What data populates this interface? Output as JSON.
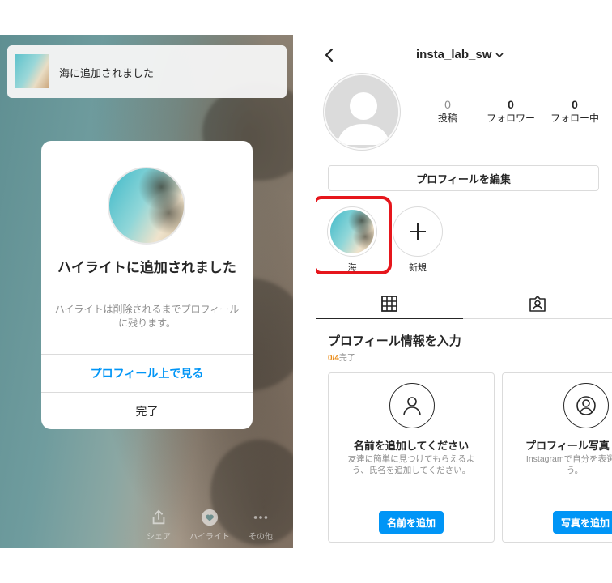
{
  "left_panel": {
    "toast": {
      "text": "海に追加されました"
    },
    "dialog": {
      "title": "ハイライトに追加されました",
      "description": "ハイライトは削除されるまでプロフィールに残ります。",
      "primary_action": "プロフィール上で見る",
      "secondary_action": "完了"
    },
    "bottom_tools": [
      {
        "label": "シェア",
        "icon": "share-icon"
      },
      {
        "label": "ハイライト",
        "icon": "heart-icon"
      },
      {
        "label": "その他",
        "icon": "more-icon"
      }
    ]
  },
  "right_panel": {
    "header": {
      "username": "insta_lab_sw"
    },
    "stats": [
      {
        "value": "0",
        "label": "投稿"
      },
      {
        "value": "0",
        "label": "フォロワー"
      },
      {
        "value": "0",
        "label": "フォロー中"
      }
    ],
    "edit_profile_label": "プロフィールを編集",
    "highlights": [
      {
        "label": "海"
      },
      {
        "label": "新規"
      }
    ],
    "highlight_box_color": "#e6161c",
    "profile_info": {
      "title": "プロフィール情報を入力",
      "progress_count": "0/4",
      "progress_suffix": "完了"
    },
    "cards": [
      {
        "title": "名前を追加してください",
        "description": "友達に簡単に見つけてもらえるよう、氏名を追加してください。",
        "button": "名前を追加",
        "icon": "person-icon"
      },
      {
        "title": "プロフィール写真",
        "description": "Instagramで自分を表選ぼう。",
        "button": "写真を追加",
        "icon": "person-circle-icon"
      }
    ],
    "accent_color": "#0095f6"
  }
}
